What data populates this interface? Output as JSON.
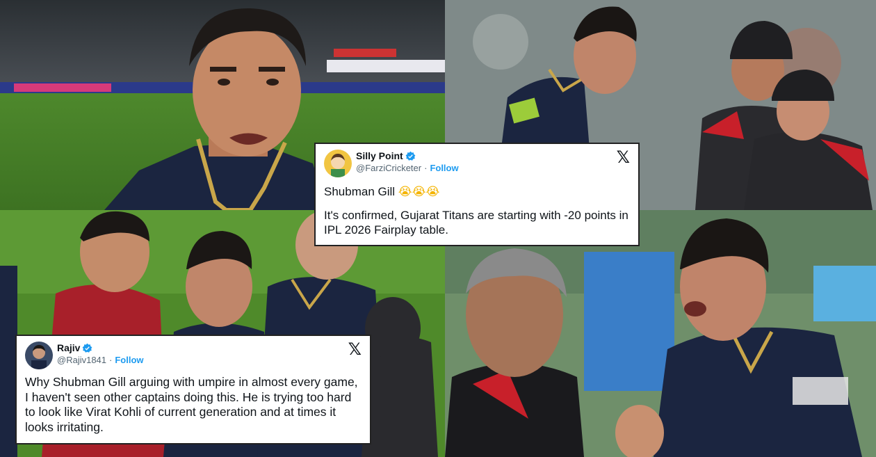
{
  "photos": {
    "top_left": "",
    "top_right": "",
    "bottom_left": "",
    "bottom_right": ""
  },
  "tweets": [
    {
      "display_name": "Silly Point",
      "handle": "@FarziCricketer",
      "separator": "·",
      "follow_label": "Follow",
      "verified_icon": "verified-badge-icon",
      "platform_icon": "x-logo-icon",
      "x_glyph": "𝕏",
      "body_line_1": "Shubman Gill",
      "body_emoji": "😭😭😭",
      "body_line_2": "It's confirmed, Gujarat Titans are starting with -20 points in IPL 2026 Fairplay table."
    },
    {
      "display_name": "Rajiv",
      "handle": "@Rajiv1841",
      "separator": "·",
      "follow_label": "Follow",
      "verified_icon": "verified-badge-icon",
      "platform_icon": "x-logo-icon",
      "x_glyph": "𝕏",
      "body": "Why Shubman Gill arguing with umpire in almost every game, I haven't seen other captains doing this. He is trying too hard to look like Virat Kohli of current generation and at times it looks irritating."
    }
  ],
  "colors": {
    "gt_navy": "#1b2540",
    "gt_gold": "#c9a64a",
    "umpire_red": "#c8202a",
    "field_green": "#4f8a2a",
    "follow_blue": "#1d9bf0"
  }
}
